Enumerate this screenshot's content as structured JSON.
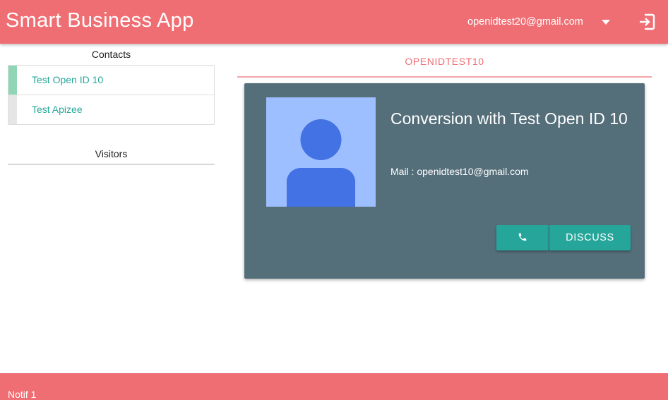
{
  "header": {
    "app_title": "Smart Business App",
    "user_email": "openidtest20@gmail.com",
    "icons": [
      "caret-down-icon",
      "logout-icon"
    ]
  },
  "sidebar": {
    "contacts_title": "Contacts",
    "contacts": [
      {
        "name": "Test Open ID 10",
        "status_color": "#8fd5b6"
      },
      {
        "name": "Test Apizee",
        "status_color": "#e6e6e6"
      }
    ],
    "visitors_title": "Visitors"
  },
  "main": {
    "tab_label": "OPENIDTEST10",
    "card": {
      "title": "Conversion with Test Open ID 10",
      "mail": "Mail : openidtest10@gmail.com",
      "avatar_icon": "person-icon",
      "call_icon": "phone-icon",
      "discuss_label": "DISCUSS"
    }
  },
  "footer": {
    "notif_text": "Notif 1"
  },
  "colors": {
    "primary": "#ef6e73",
    "accent": "#26a69a",
    "card_background": "#546e7a",
    "avatar_background": "#9ebfff",
    "avatar_figure": "#4272e3"
  }
}
